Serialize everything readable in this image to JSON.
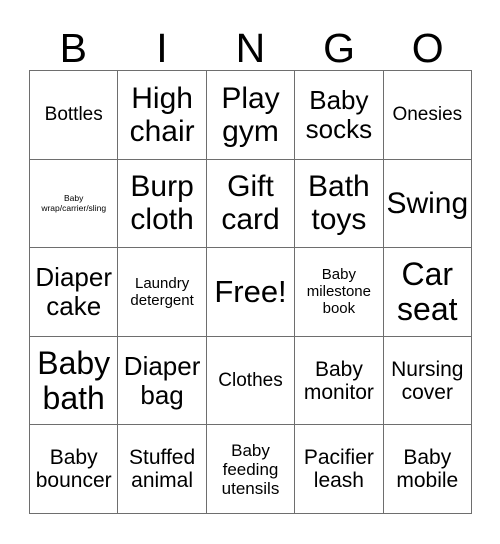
{
  "card": {
    "title": "BINGO",
    "header_letters": [
      "B",
      "I",
      "N",
      "G",
      "O"
    ],
    "columns": 5,
    "rows": 5,
    "free_space_label": "Free!",
    "free_space_position": {
      "row": 3,
      "col": 3
    },
    "border_color": "#6e6e6e",
    "background_color": "#ffffff",
    "text_color": "#000000",
    "cells": [
      {
        "text": "Bottles",
        "size": "fs-md",
        "row": 1,
        "col": 1
      },
      {
        "text": "High chair",
        "size": "fs-xxl",
        "row": 1,
        "col": 2
      },
      {
        "text": "Play gym",
        "size": "fs-xxl",
        "row": 1,
        "col": 3
      },
      {
        "text": "Baby socks",
        "size": "fs-xl",
        "row": 1,
        "col": 4
      },
      {
        "text": "Onesies",
        "size": "fs-md",
        "row": 1,
        "col": 5
      },
      {
        "text": "Baby wrap/carrier/sling",
        "size": "fs-xxs",
        "row": 2,
        "col": 1
      },
      {
        "text": "Burp cloth",
        "size": "fs-xxl",
        "row": 2,
        "col": 2
      },
      {
        "text": "Gift card",
        "size": "fs-xxl",
        "row": 2,
        "col": 3
      },
      {
        "text": "Bath toys",
        "size": "fs-xxl",
        "row": 2,
        "col": 4
      },
      {
        "text": "Swing",
        "size": "fs-xxl",
        "row": 2,
        "col": 5
      },
      {
        "text": "Diaper cake",
        "size": "fs-xl",
        "row": 3,
        "col": 1
      },
      {
        "text": "Laundry detergent",
        "size": "fs-xs",
        "row": 3,
        "col": 2
      },
      {
        "text": "Free!",
        "size": "fs-free",
        "row": 3,
        "col": 3
      },
      {
        "text": "Baby milestone book",
        "size": "fs-xs",
        "row": 3,
        "col": 4
      },
      {
        "text": "Car seat",
        "size": "fs-huge",
        "row": 3,
        "col": 5
      },
      {
        "text": "Baby bath",
        "size": "fs-huge",
        "row": 4,
        "col": 1
      },
      {
        "text": "Diaper bag",
        "size": "fs-xl",
        "row": 4,
        "col": 2
      },
      {
        "text": "Clothes",
        "size": "fs-md",
        "row": 4,
        "col": 3
      },
      {
        "text": "Baby monitor",
        "size": "fs-lg",
        "row": 4,
        "col": 4
      },
      {
        "text": "Nursing cover",
        "size": "fs-lg",
        "row": 4,
        "col": 5
      },
      {
        "text": "Baby bouncer",
        "size": "fs-lg",
        "row": 5,
        "col": 1
      },
      {
        "text": "Stuffed animal",
        "size": "fs-lg",
        "row": 5,
        "col": 2
      },
      {
        "text": "Baby feeding utensils",
        "size": "fs-sm",
        "row": 5,
        "col": 3
      },
      {
        "text": "Pacifier leash",
        "size": "fs-lg",
        "row": 5,
        "col": 4
      },
      {
        "text": "Baby mobile",
        "size": "fs-lg",
        "row": 5,
        "col": 5
      }
    ]
  }
}
